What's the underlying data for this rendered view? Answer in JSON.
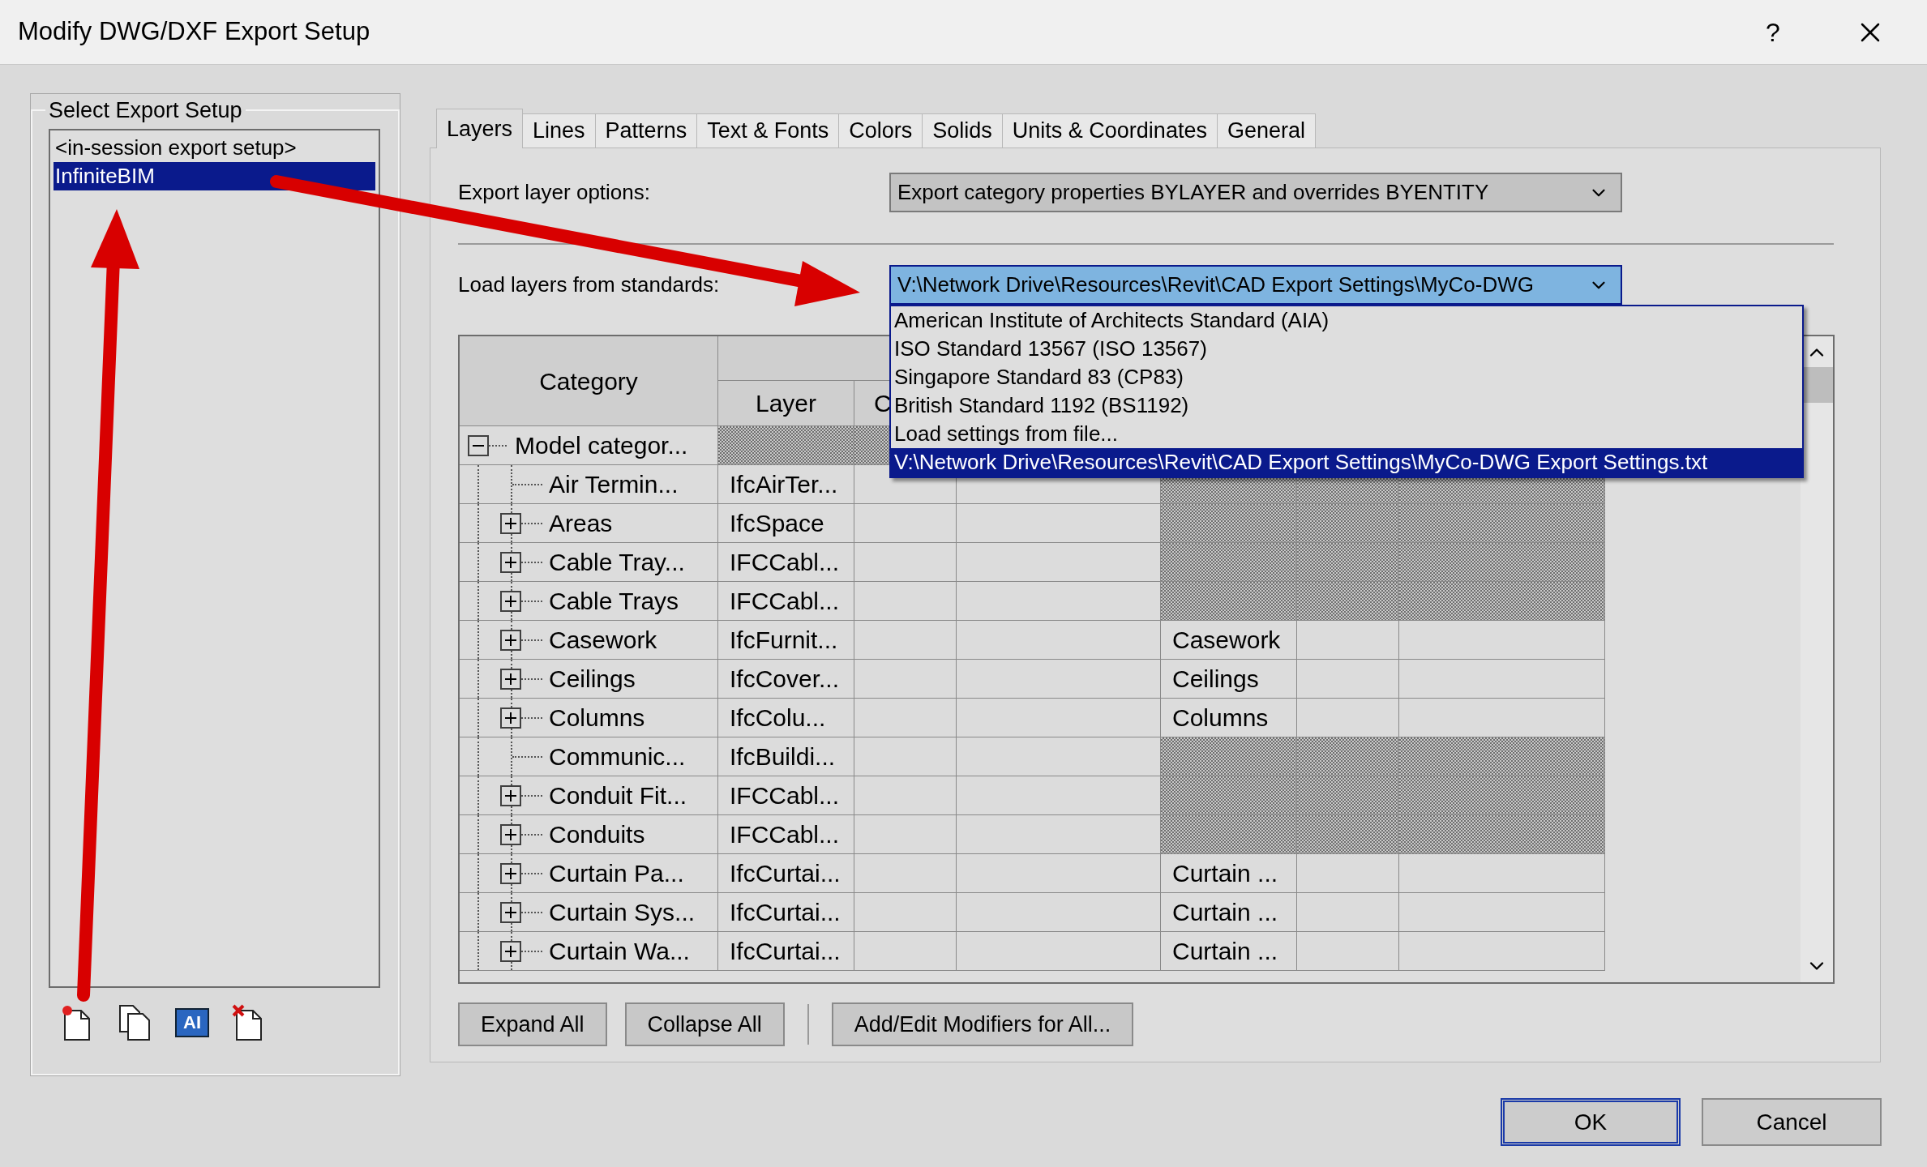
{
  "window": {
    "title": "Modify DWG/DXF Export Setup",
    "help": "?"
  },
  "setups": {
    "legend": "Select Export Setup",
    "items": [
      {
        "label": "<in-session export setup>",
        "selected": false
      },
      {
        "label": "InfiniteBIM",
        "selected": true
      }
    ],
    "rename_icon_text": "AI"
  },
  "tabs": [
    {
      "label": "Layers",
      "selected": true
    },
    {
      "label": "Lines",
      "selected": false
    },
    {
      "label": "Patterns",
      "selected": false
    },
    {
      "label": "Text & Fonts",
      "selected": false
    },
    {
      "label": "Colors",
      "selected": false
    },
    {
      "label": "Solids",
      "selected": false
    },
    {
      "label": "Units & Coordinates",
      "selected": false
    },
    {
      "label": "General",
      "selected": false
    }
  ],
  "export_layer_options": {
    "label": "Export layer options:",
    "value": "Export category properties BYLAYER and overrides BYENTITY"
  },
  "load_layers": {
    "label": "Load layers from standards:",
    "value": "V:\\Network Drive\\Resources\\Revit\\CAD Export Settings\\MyCo-DWG",
    "expanded": true,
    "options": [
      {
        "label": "American Institute of Architects Standard (AIA)",
        "selected": false
      },
      {
        "label": "ISO Standard 13567 (ISO 13567)",
        "selected": false
      },
      {
        "label": "Singapore Standard 83 (CP83)",
        "selected": false
      },
      {
        "label": "British Standard 1192 (BS1192)",
        "selected": false
      },
      {
        "label": "Load settings from file...",
        "selected": false
      },
      {
        "label": "V:\\Network Drive\\Resources\\Revit\\CAD Export Settings\\MyCo-DWG Export Settings.txt",
        "selected": true
      }
    ]
  },
  "table": {
    "columns": [
      "Category",
      "Layer",
      "C"
    ],
    "rows": [
      {
        "category": "Model categor...",
        "expanded": true,
        "shaded": true,
        "children": [
          {
            "category": "Air Termin...",
            "has_children": false,
            "layer": "IfcAirTer...",
            "shaded": true
          },
          {
            "category": "Areas",
            "has_children": true,
            "layer": "IfcSpace",
            "shaded": true
          },
          {
            "category": "Cable Tray...",
            "has_children": true,
            "layer": "IFCCabl...",
            "shaded": true
          },
          {
            "category": "Cable Trays",
            "has_children": true,
            "layer": "IFCCabl...",
            "shaded": true
          },
          {
            "category": "Casework",
            "has_children": true,
            "layer": "IfcFurnit...",
            "shaded": false,
            "column_5": "Casework"
          },
          {
            "category": "Ceilings",
            "has_children": true,
            "layer": "IfcCover...",
            "shaded": false,
            "column_5": "Ceilings"
          },
          {
            "category": "Columns",
            "has_children": true,
            "layer": "IfcColu...",
            "shaded": false,
            "column_5": "Columns"
          },
          {
            "category": "Communic...",
            "has_children": false,
            "layer": "IfcBuildi...",
            "shaded": true
          },
          {
            "category": "Conduit Fit...",
            "has_children": true,
            "layer": "IFCCabl...",
            "shaded": true
          },
          {
            "category": "Conduits",
            "has_children": true,
            "layer": "IFCCabl...",
            "shaded": true
          },
          {
            "category": "Curtain Pa...",
            "has_children": true,
            "layer": "IfcCurtai...",
            "shaded": false,
            "column_5": "Curtain ..."
          },
          {
            "category": "Curtain Sys...",
            "has_children": true,
            "layer": "IfcCurtai...",
            "shaded": false,
            "column_5": "Curtain ..."
          },
          {
            "category": "Curtain Wa...",
            "has_children": true,
            "layer": "IfcCurtai...",
            "shaded": false,
            "column_5": "Curtain ..."
          }
        ]
      }
    ]
  },
  "table_buttons": [
    "Expand All",
    "Collapse All",
    "Add/Edit Modifiers for All..."
  ],
  "dialog_buttons": [
    {
      "label": "OK",
      "default": true
    },
    {
      "label": "Cancel",
      "default": false
    }
  ]
}
